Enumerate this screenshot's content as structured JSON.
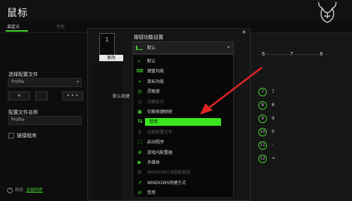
{
  "app": {
    "title": "鼠标",
    "tabs": [
      {
        "label": "自定义"
      },
      {
        "label": "性能"
      }
    ]
  },
  "sidebar": {
    "profile_label": "选择配置文件",
    "profile_value": "Profile",
    "plus_label": "+",
    "more_label": "• • •",
    "profile_name_label": "配置文件名称",
    "profile_name_value": "Profile",
    "link_program_label": "链接程序",
    "help_label": "?",
    "bottom_text": "指南",
    "sync_label": "全部同步"
  },
  "dialog": {
    "thumb_value": "1",
    "change_button": "更改",
    "close_label": "×",
    "default_key_label": "默认按键",
    "section_title": "按钮功能设置",
    "select_value": "默认",
    "select_arrow": "▾",
    "functions": [
      {
        "icon": "default-icon",
        "glyph": "⟝",
        "label": "默认",
        "dim": false
      },
      {
        "icon": "keyboard-icon",
        "glyph": "⌨",
        "label": "键盘功能",
        "dim": false
      },
      {
        "icon": "mouse-icon",
        "glyph": "⌖",
        "label": "鼠标功能",
        "dim": false
      },
      {
        "icon": "sensitivity-icon",
        "glyph": "◎",
        "label": "灵敏度",
        "dim": false
      },
      {
        "icon": "macro-icon",
        "glyph": "◷",
        "label": "切换宏开",
        "dim": true
      },
      {
        "icon": "switch-key-icon",
        "glyph": "▣",
        "label": "切换按键映射",
        "dim": false
      },
      {
        "icon": "swap-icon",
        "glyph": "⇆",
        "label": "禁用",
        "dim": false,
        "selected": true
      },
      {
        "icon": "switch-profile-icon",
        "glyph": "⇅",
        "label": "切换配置文件",
        "dim": true
      },
      {
        "icon": "launch-icon",
        "glyph": "⬚",
        "label": "启动程序",
        "dim": false
      },
      {
        "icon": "chroma-icon",
        "glyph": "⊕",
        "label": "游戏内配置器",
        "dim": false
      },
      {
        "icon": "multimedia-icon",
        "glyph": "▶",
        "label": "多媒体",
        "dim": false
      },
      {
        "icon": "windows-icon",
        "glyph": "⊞",
        "label": "WINDOWS 8超级按钮",
        "dim": true
      },
      {
        "icon": "shortcut-icon",
        "glyph": "↗",
        "label": "WINDOWS快捷方式",
        "dim": false
      },
      {
        "icon": "disable-icon",
        "glyph": "⊘",
        "label": "禁用",
        "dim": false
      }
    ]
  },
  "keypad": {
    "columns": [
      "6",
      "7",
      "8"
    ],
    "rows": [
      {
        "num": "7",
        "value": "7"
      },
      {
        "num": "8",
        "value": "8"
      },
      {
        "num": "9",
        "value": "9"
      },
      {
        "num": "10",
        "value": "0"
      },
      {
        "num": "11",
        "value": "-"
      },
      {
        "num": "12",
        "value": "="
      }
    ]
  },
  "colors": {
    "accent": "#44d62c",
    "selected": "#39e61e",
    "annotation_arrow": "#e02424"
  }
}
